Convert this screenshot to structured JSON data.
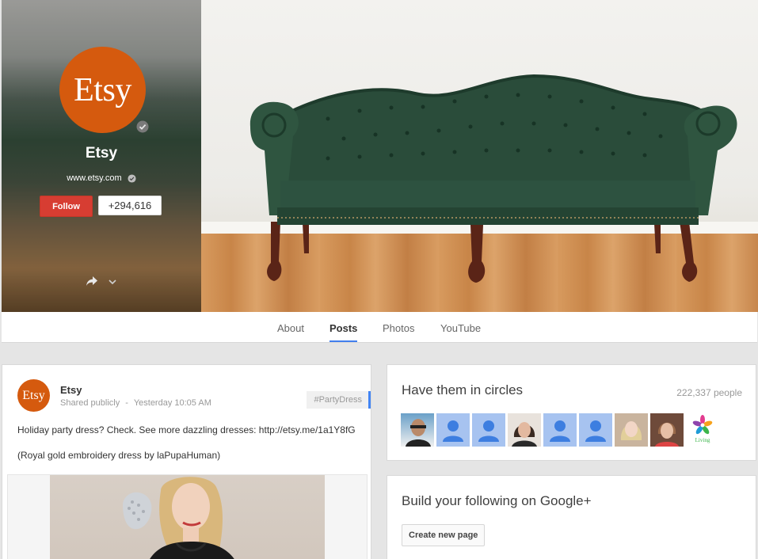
{
  "profile": {
    "logo_text": "Etsy",
    "name": "Etsy",
    "url": "www.etsy.com",
    "follow_label": "Follow",
    "plus_count": "+294,616"
  },
  "tabs": [
    {
      "label": "About",
      "active": false
    },
    {
      "label": "Posts",
      "active": true
    },
    {
      "label": "Photos",
      "active": false
    },
    {
      "label": "YouTube",
      "active": false
    }
  ],
  "post": {
    "avatar_text": "Etsy",
    "author": "Etsy",
    "visibility": "Shared publicly",
    "separator": "-",
    "timestamp": "Yesterday 10:05 AM",
    "hashtag": "#PartyDress",
    "text": "Holiday party dress? Check. See more dazzling dresses: http://etsy.me/1a1Y8fG",
    "caption": "(Royal gold embroidery dress by laPupaHuman)"
  },
  "circles": {
    "title": "Have them in circles",
    "count": "222,337 people",
    "faces": [
      "photo",
      "blank",
      "blank",
      "photo",
      "blank",
      "blank",
      "photo",
      "photo",
      "logo"
    ],
    "logo_face_text": "Living"
  },
  "build": {
    "title": "Build your following on Google+",
    "button_label": "Create new page"
  },
  "colors": {
    "etsy_orange": "#d55a0e",
    "follow_red": "#d73d32",
    "accent_blue": "#427fed",
    "blank_avatar": "#a7c3f0"
  }
}
